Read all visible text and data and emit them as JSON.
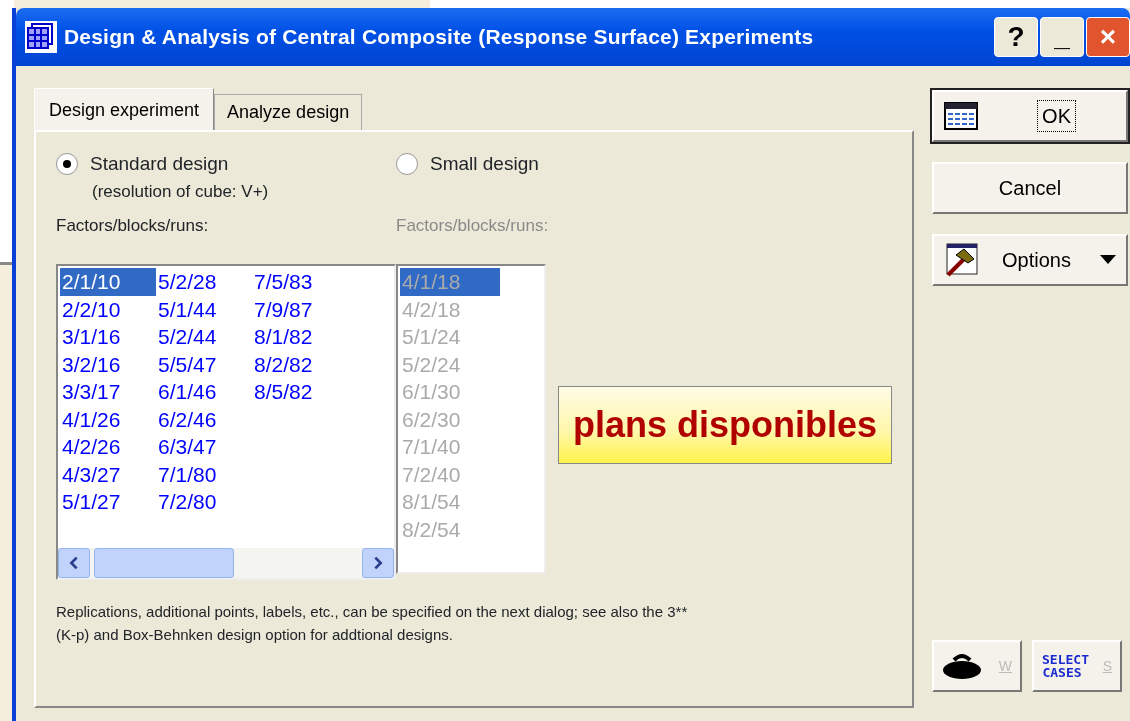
{
  "window": {
    "title": "Design & Analysis of Central Composite (Response Surface) Experiments",
    "title_buttons": [
      {
        "kind": "help",
        "label": "?"
      },
      {
        "kind": "minimize",
        "label": "_"
      },
      {
        "kind": "close",
        "label": "×"
      }
    ]
  },
  "tabs": [
    {
      "label": "Design experiment",
      "selected": true
    },
    {
      "label": "Analyze design",
      "selected": false
    }
  ],
  "designs": [
    {
      "label": "Standard design",
      "sublabel": "(resolution of cube: V+)",
      "selected": true,
      "list_label": "Factors/blocks/runs:",
      "disabled": false,
      "items": [
        {
          "text": "2/1/10",
          "selected": true
        },
        {
          "text": "2/2/10",
          "selected": false
        },
        {
          "text": "3/1/16",
          "selected": false
        },
        {
          "text": "3/2/16",
          "selected": false
        },
        {
          "text": "3/3/17",
          "selected": false
        },
        {
          "text": "4/1/26",
          "selected": false
        },
        {
          "text": "4/2/26",
          "selected": false
        },
        {
          "text": "4/3/27",
          "selected": false
        },
        {
          "text": "5/1/27",
          "selected": false
        },
        {
          "text": "5/2/28",
          "selected": false
        },
        {
          "text": "5/1/44",
          "selected": false
        },
        {
          "text": "5/2/44",
          "selected": false
        },
        {
          "text": "5/5/47",
          "selected": false
        },
        {
          "text": "6/1/46",
          "selected": false
        },
        {
          "text": "6/2/46",
          "selected": false
        },
        {
          "text": "6/3/47",
          "selected": false
        },
        {
          "text": "7/1/80",
          "selected": false
        },
        {
          "text": "7/2/80",
          "selected": false
        },
        {
          "text": "7/5/83",
          "selected": false
        },
        {
          "text": "7/9/87",
          "selected": false
        },
        {
          "text": "8/1/82",
          "selected": false
        },
        {
          "text": "8/2/82",
          "selected": false
        },
        {
          "text": "8/5/82",
          "selected": false
        }
      ]
    },
    {
      "label": "Small design",
      "selected": false,
      "list_label": "Factors/blocks/runs:",
      "disabled": true,
      "items": [
        {
          "text": "4/1/18",
          "selected": true
        },
        {
          "text": "4/2/18",
          "selected": false
        },
        {
          "text": "5/1/24",
          "selected": false
        },
        {
          "text": "5/2/24",
          "selected": false
        },
        {
          "text": "6/1/30",
          "selected": false
        },
        {
          "text": "6/2/30",
          "selected": false
        },
        {
          "text": "7/1/40",
          "selected": false
        },
        {
          "text": "7/2/40",
          "selected": false
        },
        {
          "text": "8/1/54",
          "selected": false
        },
        {
          "text": "8/2/54",
          "selected": false
        }
      ]
    }
  ],
  "callout": "plans disponibles",
  "note": "Replications, additional points, labels, etc., can be specified on the next dialog; see also the 3**(K-p) and Box-Behnken design option for addtional designs.",
  "buttons": [
    {
      "kind": "ok",
      "label": "OK"
    },
    {
      "kind": "cancel",
      "label": "Cancel"
    },
    {
      "kind": "options",
      "label": "Options"
    }
  ],
  "bottom_buttons": [
    {
      "kind": "weight",
      "label": "W"
    },
    {
      "kind": "select",
      "label": "SELECT CASES",
      "hotkey": "S"
    }
  ]
}
